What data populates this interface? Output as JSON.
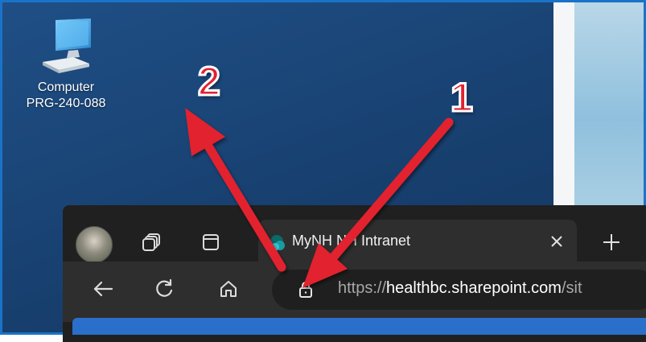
{
  "desktop": {
    "icon_label_line1": "Computer",
    "icon_label_line2": "PRG-240-088",
    "icon_name": "computer-monitor-icon"
  },
  "browser": {
    "tab_title": "MyNH  NH Intranet",
    "tab_favicon": "sharepoint-icon",
    "tab_close_label": "×",
    "new_tab_label": "+",
    "url_protocol": "https://",
    "url_host": "healthbc.sharepoint.com",
    "url_path": "/sit",
    "icons": [
      "profile-avatar",
      "workspaces-icon",
      "tab-actions-icon",
      "back-arrow-icon",
      "refresh-icon",
      "home-icon",
      "lock-icon"
    ]
  },
  "annotations": {
    "label_1": "1",
    "label_2": "2",
    "color": "#e2212f"
  }
}
